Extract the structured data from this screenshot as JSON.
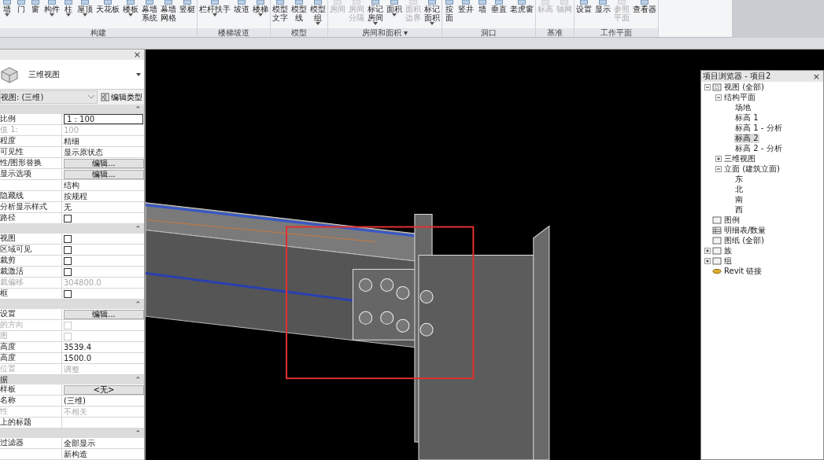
{
  "ribbon": {
    "groups": [
      {
        "title": "构建",
        "tools": [
          {
            "lines": [
              "墙"
            ],
            "dropdown": true,
            "disabled": false
          },
          {
            "lines": [
              "门"
            ],
            "dropdown": false,
            "disabled": false
          },
          {
            "lines": [
              "窗"
            ],
            "dropdown": false,
            "disabled": false
          },
          {
            "lines": [
              "构件"
            ],
            "dropdown": true,
            "disabled": false
          },
          {
            "lines": [
              "柱"
            ],
            "dropdown": true,
            "disabled": false
          },
          {
            "lines": [
              "屋顶"
            ],
            "dropdown": true,
            "disabled": false
          },
          {
            "lines": [
              "天花板"
            ],
            "dropdown": false,
            "disabled": false
          },
          {
            "lines": [
              "楼板"
            ],
            "dropdown": true,
            "disabled": false
          },
          {
            "lines": [
              "幕墙",
              "系统"
            ],
            "dropdown": false,
            "disabled": false
          },
          {
            "lines": [
              "幕墙",
              "网格"
            ],
            "dropdown": false,
            "disabled": false
          },
          {
            "lines": [
              "竖梃"
            ],
            "dropdown": false,
            "disabled": false
          }
        ]
      },
      {
        "title": "楼梯坡道",
        "tools": [
          {
            "lines": [
              "栏杆扶手"
            ],
            "dropdown": true,
            "disabled": false
          },
          {
            "lines": [
              "坡道"
            ],
            "dropdown": false,
            "disabled": false
          },
          {
            "lines": [
              "楼梯"
            ],
            "dropdown": true,
            "disabled": false
          }
        ]
      },
      {
        "title": "模型",
        "tools": [
          {
            "lines": [
              "模型",
              "文字"
            ],
            "dropdown": false,
            "disabled": false
          },
          {
            "lines": [
              "模型",
              "线"
            ],
            "dropdown": false,
            "disabled": false
          },
          {
            "lines": [
              "模型",
              "组"
            ],
            "dropdown": true,
            "disabled": false
          }
        ]
      },
      {
        "title": "房间和面积 ▾",
        "tools": [
          {
            "lines": [
              "房间"
            ],
            "dropdown": false,
            "disabled": true
          },
          {
            "lines": [
              "房间",
              "分隔"
            ],
            "dropdown": false,
            "disabled": true
          },
          {
            "lines": [
              "标记",
              "房间"
            ],
            "dropdown": true,
            "disabled": false
          },
          {
            "lines": [
              "面积"
            ],
            "dropdown": true,
            "disabled": false
          },
          {
            "lines": [
              "面积",
              "边界"
            ],
            "dropdown": false,
            "disabled": true
          },
          {
            "lines": [
              "标记",
              "面积"
            ],
            "dropdown": true,
            "disabled": false
          }
        ]
      },
      {
        "title": "洞口",
        "tools": [
          {
            "lines": [
              "按",
              "面"
            ],
            "dropdown": false,
            "disabled": false
          },
          {
            "lines": [
              "竖井"
            ],
            "dropdown": false,
            "disabled": false
          },
          {
            "lines": [
              "墙"
            ],
            "dropdown": false,
            "disabled": false
          },
          {
            "lines": [
              "垂直"
            ],
            "dropdown": false,
            "disabled": false
          },
          {
            "lines": [
              "老虎窗"
            ],
            "dropdown": false,
            "disabled": false
          }
        ]
      },
      {
        "title": "基准",
        "tools": [
          {
            "lines": [
              "标高"
            ],
            "dropdown": false,
            "disabled": true
          },
          {
            "lines": [
              "轴网"
            ],
            "dropdown": false,
            "disabled": true
          }
        ]
      },
      {
        "title": "工作平面",
        "tools": [
          {
            "lines": [
              "设置"
            ],
            "dropdown": false,
            "disabled": false
          },
          {
            "lines": [
              "显示"
            ],
            "dropdown": false,
            "disabled": false
          },
          {
            "lines": [
              "参照",
              "平面"
            ],
            "dropdown": false,
            "disabled": true
          },
          {
            "lines": [
              "查看器"
            ],
            "dropdown": false,
            "disabled": false
          }
        ]
      }
    ]
  },
  "properties": {
    "close": "×",
    "type_name": "三维视图",
    "instance_selector": "视图: (三维)",
    "edit_type": "编辑类型",
    "sections": [
      {
        "toggle": "⌃",
        "rows": [
          {
            "label": "比例",
            "kind": "input",
            "value": "1 : 100"
          },
          {
            "label": "值 1:",
            "kind": "text",
            "value": "100",
            "disabled": true
          },
          {
            "label": "程度",
            "kind": "text",
            "value": "精细",
            "disabled": false
          },
          {
            "label": "可见性",
            "kind": "text",
            "value": "显示原状态",
            "disabled": false
          },
          {
            "label": "性/图形替换",
            "kind": "button",
            "value": "编辑..."
          },
          {
            "label": "显示选项",
            "kind": "button",
            "value": "编辑..."
          },
          {
            "kind": "text",
            "value": "结构",
            "disabled": false
          },
          {
            "label": "隐藏线",
            "kind": "text",
            "value": "按规程",
            "disabled": false
          },
          {
            "label": "分析显示样式",
            "kind": "text",
            "value": "无",
            "disabled": false
          },
          {
            "label": "路径",
            "kind": "checkbox",
            "checked": false,
            "disabled": false
          }
        ]
      },
      {
        "toggle": "⌃",
        "rows": [
          {
            "label": "视图",
            "kind": "checkbox",
            "checked": false,
            "disabled": false
          },
          {
            "label": "区域可见",
            "kind": "checkbox",
            "checked": false,
            "disabled": false
          },
          {
            "label": "裁剪",
            "kind": "checkbox",
            "checked": false,
            "disabled": false
          },
          {
            "label": "裁激活",
            "kind": "checkbox",
            "checked": false,
            "disabled": false
          },
          {
            "label": "裁偏移",
            "kind": "text",
            "value": "304800.0",
            "disabled": true
          },
          {
            "label": "框",
            "kind": "checkbox",
            "checked": false,
            "disabled": false
          }
        ]
      },
      {
        "toggle": "⌃",
        "rows": [
          {
            "label": "设置",
            "kind": "button",
            "value": "编辑..."
          },
          {
            "label": "的方向",
            "kind": "checkbox",
            "checked": false,
            "disabled": true
          },
          {
            "label": "图",
            "kind": "checkbox",
            "checked": false,
            "disabled": true
          },
          {
            "label": "高度",
            "kind": "text",
            "value": "3539.4",
            "disabled": false
          },
          {
            "label": "高度",
            "kind": "text",
            "value": "1500.0",
            "disabled": false
          },
          {
            "label": "位置",
            "kind": "text",
            "value": "调整",
            "disabled": true
          }
        ]
      },
      {
        "title": "据",
        "toggle": "⌃",
        "rows": [
          {
            "label": "样板",
            "kind": "button",
            "value": "<无>"
          },
          {
            "label": "名称",
            "kind": "text",
            "value": "(三维)",
            "disabled": false
          },
          {
            "label": "性",
            "kind": "text",
            "value": "不相关",
            "disabled": true
          },
          {
            "label": "上的标题",
            "kind": "text",
            "disabled": false
          }
        ]
      },
      {
        "toggle": "⌃",
        "rows": [
          {
            "label": "过滤器",
            "kind": "text",
            "value": "全部显示",
            "disabled": false
          },
          {
            "kind": "text",
            "value": "新构造",
            "disabled": false
          }
        ]
      }
    ]
  },
  "project_browser": {
    "title": "项目浏览器 - 项目2",
    "close": "×",
    "tree": [
      {
        "label": "视图 (全部)",
        "kind": "views",
        "expanded": true,
        "selected": false,
        "children": [
          {
            "label": "结构平面",
            "expanded": true,
            "selected": false,
            "children": [
              {
                "label": "场地",
                "selected": false
              },
              {
                "label": "标高 1",
                "selected": false
              },
              {
                "label": "标高 1 - 分析",
                "selected": false
              },
              {
                "label": "标高 2",
                "selected": true
              },
              {
                "label": "标高 2 - 分析",
                "selected": false
              }
            ]
          },
          {
            "label": "三维视图",
            "expanded": false,
            "selected": false
          },
          {
            "label": "立面 (建筑立面)",
            "expanded": true,
            "selected": false,
            "children": [
              {
                "label": "东",
                "selected": false
              },
              {
                "label": "北",
                "selected": false
              },
              {
                "label": "南",
                "selected": false
              },
              {
                "label": "西",
                "selected": false
              }
            ]
          }
        ]
      },
      {
        "label": "图例",
        "kind": "legend",
        "selected": false
      },
      {
        "label": "明细表/数量",
        "kind": "schedule",
        "selected": false
      },
      {
        "label": "图纸 (全部)",
        "kind": "sheet",
        "selected": false
      },
      {
        "label": "族",
        "kind": "family",
        "expanded": false,
        "selected": false
      },
      {
        "label": "组",
        "kind": "group",
        "expanded": false,
        "selected": false
      },
      {
        "label": "Revit 链接",
        "kind": "link",
        "selected": false
      }
    ]
  }
}
